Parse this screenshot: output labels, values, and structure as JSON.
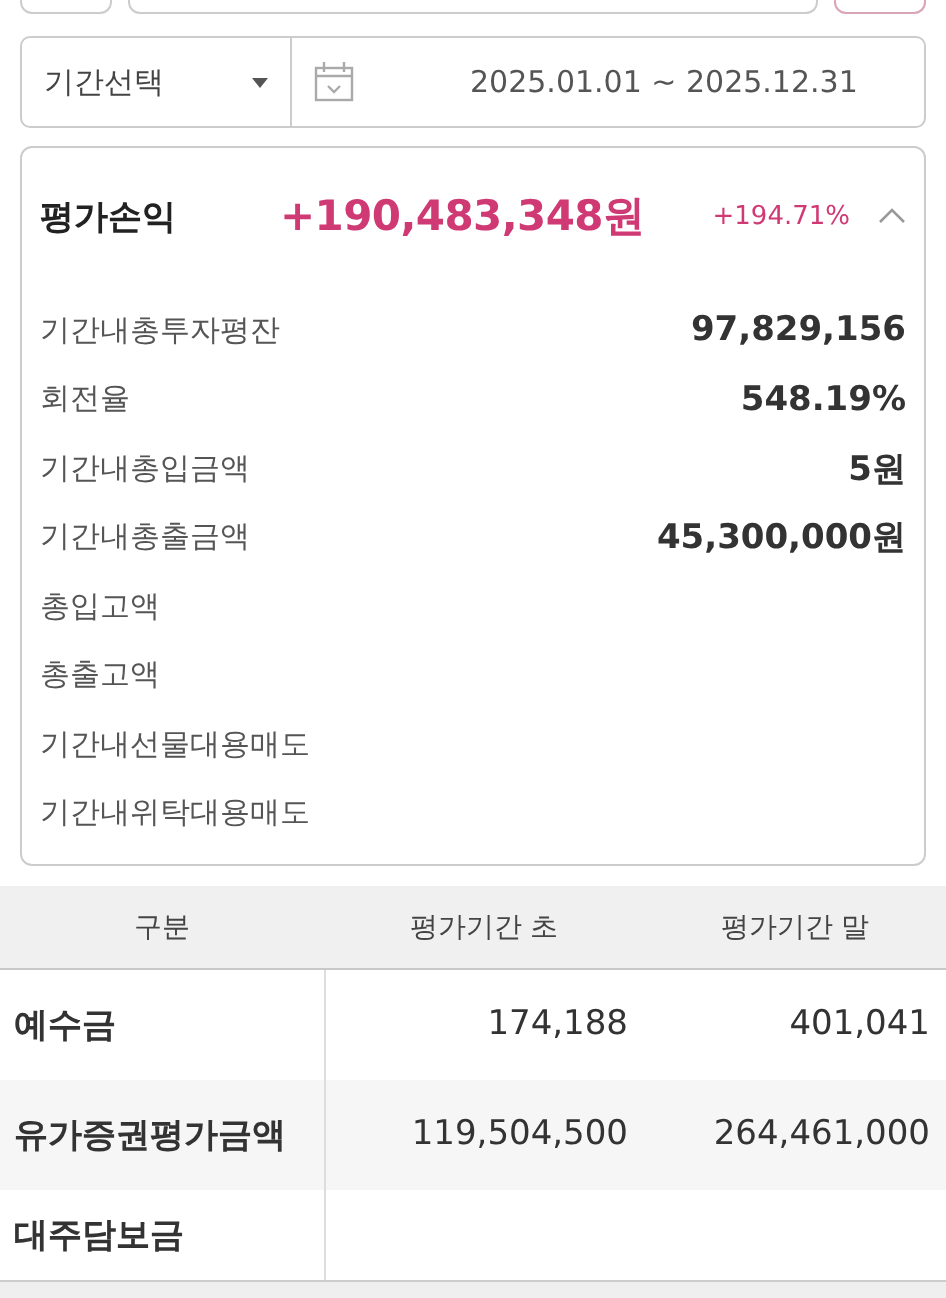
{
  "top_controls": [
    {
      "kind": "button"
    },
    {
      "kind": "field"
    },
    {
      "kind": "accent_button"
    }
  ],
  "period": {
    "select": "기간선택",
    "range": "2025.01.01 ~ 2025.12.31"
  },
  "summary": {
    "label": "평가손익",
    "amount": "+190,483,348원",
    "rate": "+194.71%",
    "expanded": true,
    "rows": [
      {
        "label": "기간내총투자평잔",
        "value": "97,829,156"
      },
      {
        "label": "회전율",
        "value": "548.19%"
      },
      {
        "label": "기간내총입금액",
        "value": "5원"
      },
      {
        "label": "기간내총출금액",
        "value": "45,300,000원"
      },
      {
        "label": "총입고액"
      },
      {
        "label": "총출고액"
      },
      {
        "label": "기간내선물대용매도"
      },
      {
        "label": "기간내위탁대용매도"
      }
    ]
  },
  "table": {
    "columns": [
      "구분",
      "평가기간 초",
      "평가기간 말"
    ],
    "rows": [
      [
        "예수금",
        "174,188",
        "401,041"
      ],
      [
        "유가증권평가금액",
        "119,504,500",
        "264,461,000"
      ],
      [
        "대주담보금",
        "",
        ""
      ]
    ]
  }
}
